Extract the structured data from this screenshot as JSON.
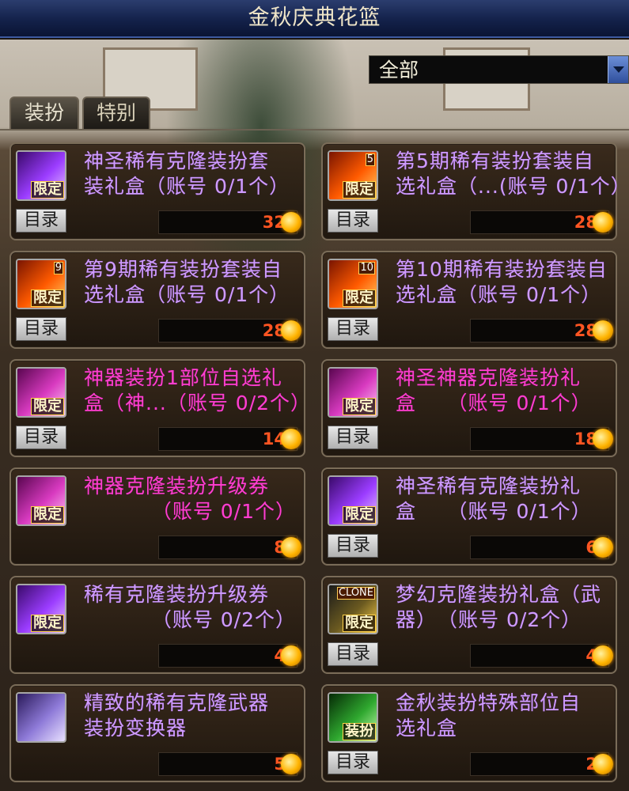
{
  "window": {
    "title": "金秋庆典花篮"
  },
  "filter": {
    "value": "全部"
  },
  "tabs": [
    {
      "label": "装扮",
      "active": true
    },
    {
      "label": "特别",
      "active": false
    }
  ],
  "catalog_label": "目录",
  "colors": {
    "purple_name": "#cf9cff",
    "pink_name": "#ff3fd0",
    "price": "#ff5522",
    "coin": "#ffb300"
  },
  "items": [
    {
      "line1": "神圣稀有克隆装扮套",
      "line2": "装礼盒（账号 0/1个）",
      "price": "32",
      "tag": "限定",
      "num": "",
      "icon": "purple-costume-box-icon",
      "color": "purple",
      "has_catalog": true
    },
    {
      "line1": "第5期稀有装扮套装自",
      "line2": "选礼盒（...(账号 0/1个）",
      "price": "28",
      "tag": "限定",
      "num": "5",
      "icon": "orange-costume-box-icon",
      "color": "purple",
      "has_catalog": true
    },
    {
      "line1": "第9期稀有装扮套装自",
      "line2": "选礼盒（账号 0/1个）",
      "price": "28",
      "tag": "限定",
      "num": "9",
      "icon": "orange-costume-box-icon",
      "color": "purple",
      "has_catalog": true
    },
    {
      "line1": "第10期稀有装扮套装自",
      "line2": "选礼盒（账号 0/1个）",
      "price": "28",
      "tag": "限定",
      "num": "10",
      "icon": "orange-costume-box-icon",
      "color": "purple",
      "has_catalog": true
    },
    {
      "line1": "神器装扮1部位自选礼",
      "line2": "盒（神...（账号 0/2个）",
      "price": "14",
      "tag": "限定",
      "num": "",
      "icon": "pink-costume-box-icon",
      "color": "pink",
      "has_catalog": true
    },
    {
      "line1": "神圣神器克隆装扮礼",
      "line2": "盒　　（账号 0/1个）",
      "price": "18",
      "tag": "限定",
      "num": "",
      "icon": "pink-costume-box-icon",
      "color": "pink",
      "has_catalog": true
    },
    {
      "line1": "神器克隆装扮升级券",
      "line2": "（账号 0/1个）",
      "price": "8",
      "tag": "限定",
      "num": "",
      "icon": "pink-upgrade-ticket-icon",
      "color": "pink",
      "has_catalog": false
    },
    {
      "line1": "神圣稀有克隆装扮礼",
      "line2": "盒　　（账号 0/1个）",
      "price": "6",
      "tag": "限定",
      "num": "",
      "icon": "purple-costume-box-icon",
      "color": "purple",
      "has_catalog": true
    },
    {
      "line1": "稀有克隆装扮升级券",
      "line2": "（账号 0/2个）",
      "price": "4",
      "tag": "限定",
      "num": "",
      "icon": "purple-upgrade-ticket-icon",
      "color": "purple",
      "has_catalog": false
    },
    {
      "line1": "梦幻克隆装扮礼盒（武",
      "line2": "器）　（账号 0/2个）",
      "price": "4",
      "tag": "限定",
      "num": "CLONE",
      "icon": "clone-weapon-box-icon",
      "color": "purple",
      "has_catalog": true
    },
    {
      "line1": "精致的稀有克隆武器",
      "line2": "装扮变换器",
      "price": "5",
      "tag": "",
      "num": "",
      "icon": "weapon-converter-icon",
      "color": "purple",
      "has_catalog": false
    },
    {
      "line1": "金秋装扮特殊部位自",
      "line2": "选礼盒",
      "price": "2",
      "tag": "装扮",
      "num": "",
      "icon": "green-costume-part-icon",
      "color": "purple",
      "has_catalog": true
    }
  ]
}
